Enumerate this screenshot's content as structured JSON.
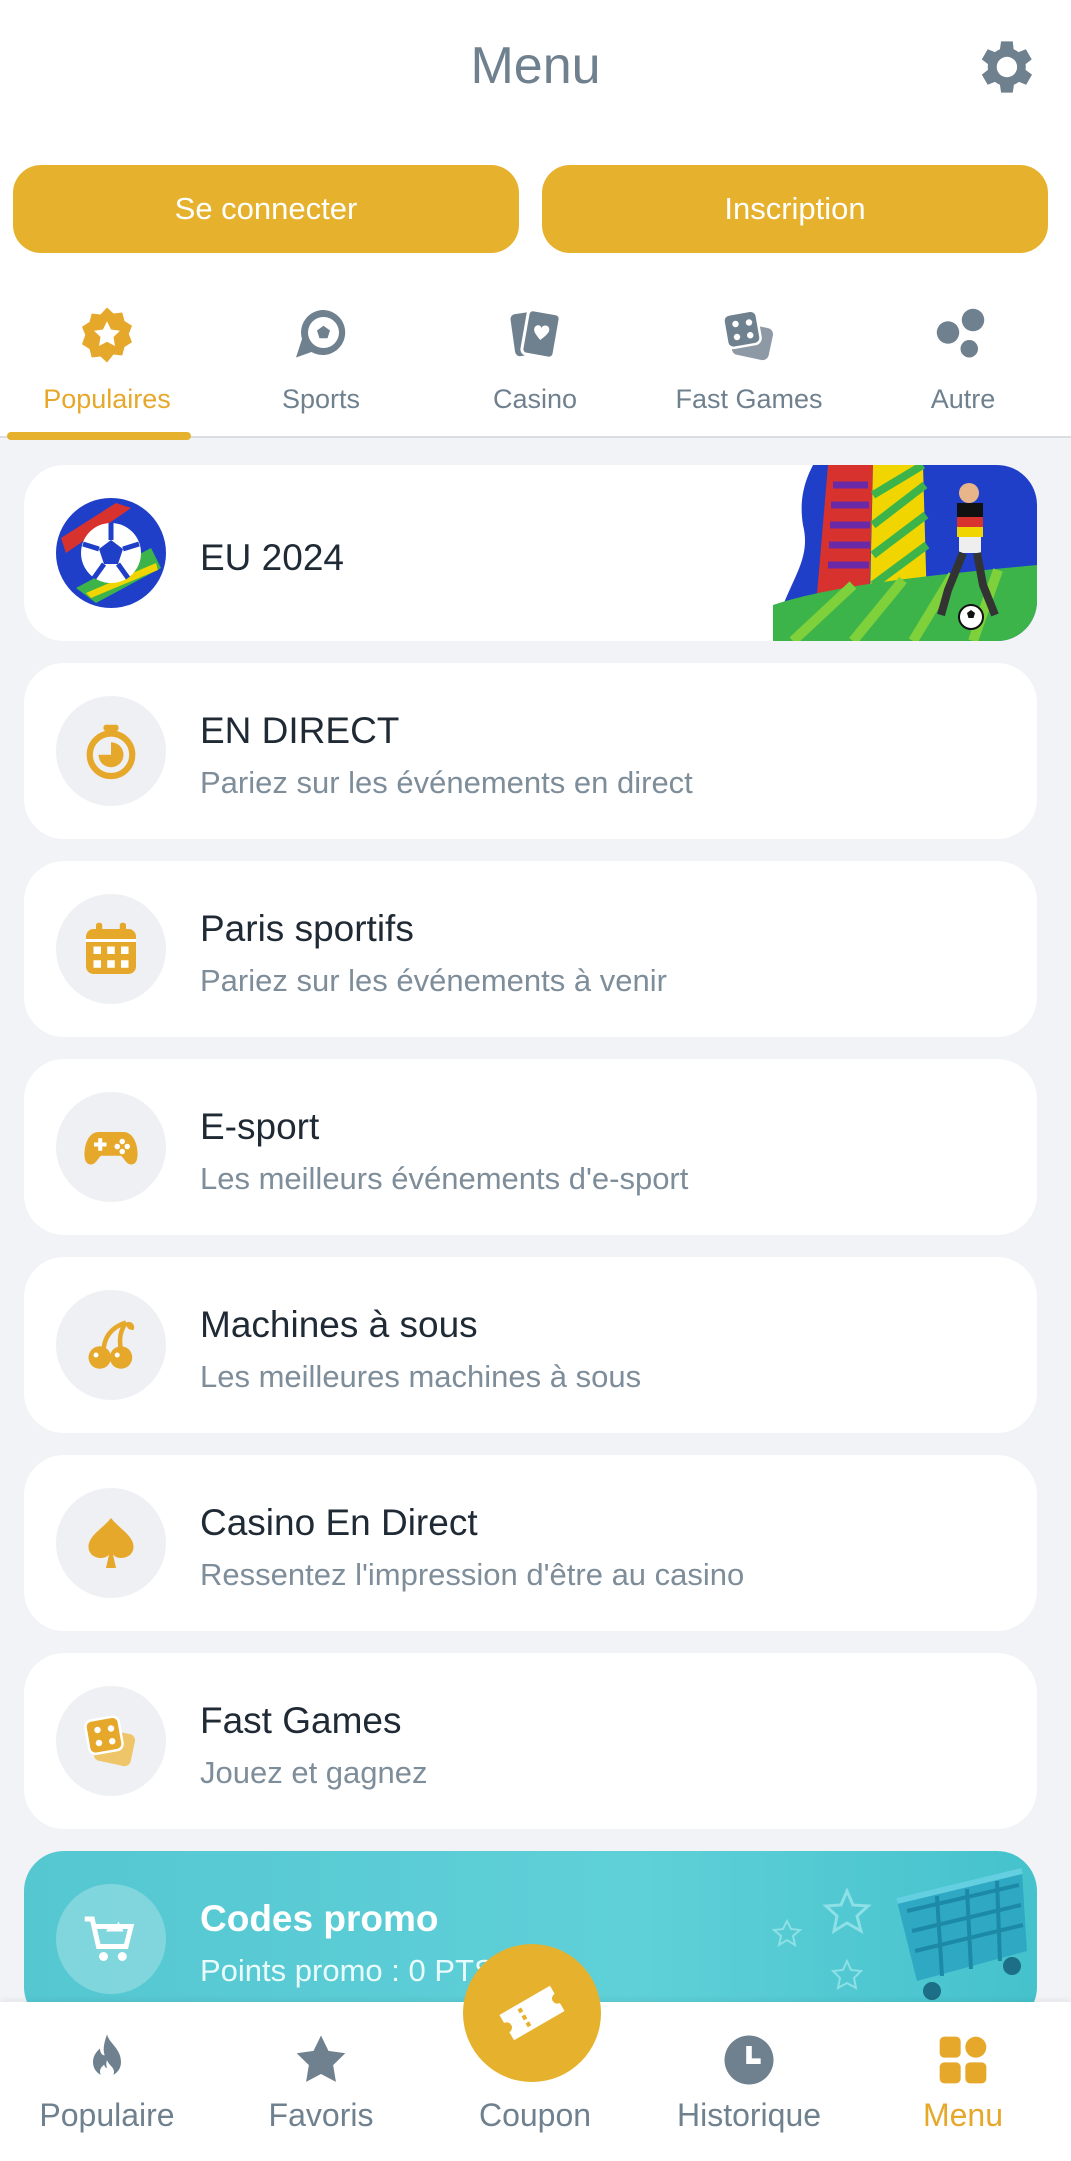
{
  "header": {
    "title": "Menu",
    "settings_icon": "gear-icon"
  },
  "auth": {
    "login_label": "Se connecter",
    "signup_label": "Inscription"
  },
  "tabs": [
    {
      "label": "Populaires",
      "icon": "star-badge-icon",
      "active": true
    },
    {
      "label": "Sports",
      "icon": "soccer-ball-icon",
      "active": false
    },
    {
      "label": "Casino",
      "icon": "playing-card-icon",
      "active": false
    },
    {
      "label": "Fast Games",
      "icon": "dice-icon",
      "active": false
    },
    {
      "label": "Autre",
      "icon": "bubbles-icon",
      "active": false
    }
  ],
  "menu_items": [
    {
      "title": "EU 2024",
      "subtitle": "",
      "icon": "eu-2024-ball-icon"
    },
    {
      "title": "EN DIRECT",
      "subtitle": "Pariez sur les événements en direct",
      "icon": "stopwatch-icon"
    },
    {
      "title": "Paris sportifs",
      "subtitle": "Pariez sur les événements à venir",
      "icon": "calendar-icon"
    },
    {
      "title": "E-sport",
      "subtitle": "Les meilleurs événements d'e-sport",
      "icon": "gamepad-icon"
    },
    {
      "title": "Machines à sous",
      "subtitle": "Les meilleures machines à sous",
      "icon": "cherries-icon"
    },
    {
      "title": "Casino En Direct",
      "subtitle": "Ressentez l'impression d'être au casino",
      "icon": "spade-icon"
    },
    {
      "title": "Fast Games",
      "subtitle": "Jouez et gagnez",
      "icon": "dice-icon"
    }
  ],
  "promo": {
    "title": "Codes promo",
    "subtitle": "Points promo : 0 PTS",
    "icon": "cart-icon"
  },
  "bottom_nav": [
    {
      "label": "Populaire",
      "icon": "flame-icon",
      "active": false
    },
    {
      "label": "Favoris",
      "icon": "star-icon",
      "active": false
    },
    {
      "label": "Coupon",
      "icon": "ticket-icon",
      "active": false
    },
    {
      "label": "Historique",
      "icon": "clock-icon",
      "active": false
    },
    {
      "label": "Menu",
      "icon": "grid-icon",
      "active": true
    }
  ],
  "colors": {
    "accent": "#e6b12c",
    "text_muted": "#6f808e",
    "background": "#f1f3f6",
    "promo": "#55c7d1"
  }
}
